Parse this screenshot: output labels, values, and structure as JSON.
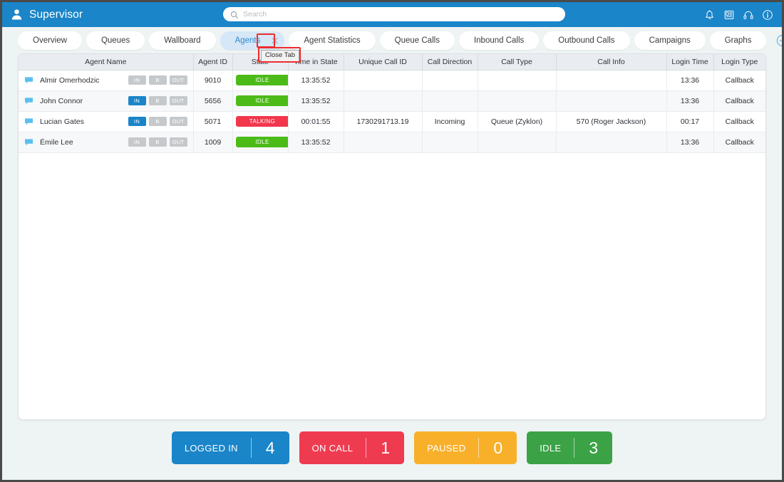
{
  "header": {
    "title": "Supervisor",
    "user_icon": "user-icon",
    "search": {
      "placeholder": "Search",
      "value": ""
    },
    "icons": [
      {
        "name": "bell-icon",
        "label": "Notifications"
      },
      {
        "name": "desk-phone-icon",
        "label": "Phone"
      },
      {
        "name": "headset-icon",
        "label": "Headset"
      },
      {
        "name": "info-icon",
        "label": "Info"
      }
    ],
    "accent_color": "#1a85c8"
  },
  "tabs": {
    "items": [
      {
        "label": "Overview",
        "active": false
      },
      {
        "label": "Queues",
        "active": false
      },
      {
        "label": "Wallboard",
        "active": false
      },
      {
        "label": "Agents",
        "active": true
      },
      {
        "label": "Agent Statistics",
        "active": false
      },
      {
        "label": "Queue Calls",
        "active": false
      },
      {
        "label": "Inbound Calls",
        "active": false
      },
      {
        "label": "Outbound Calls",
        "active": false
      },
      {
        "label": "Campaigns",
        "active": false
      },
      {
        "label": "Graphs",
        "active": false
      }
    ],
    "add_tab_icon": "plus-circle-icon",
    "close_icon": "close-icon",
    "tooltip": "Close Tab"
  },
  "table": {
    "columns": [
      "Agent Name",
      "Agent ID",
      "State",
      "Time in State",
      "Unique Call ID",
      "Call Direction",
      "Call Type",
      "Call Info",
      "Login Time",
      "Login Type"
    ],
    "badge_labels": {
      "in": "IN",
      "b": "B",
      "out": "OUT"
    },
    "rows": [
      {
        "agent_name": "Almir Omerhodzic",
        "badges": {
          "in": false,
          "b": false,
          "out": false
        },
        "agent_id": "9010",
        "state": "IDLE",
        "state_type": "idle",
        "time_in_state": "13:35:52",
        "unique_call_id": "",
        "call_direction": "",
        "call_type": "",
        "call_info": "",
        "login_time": "13:36",
        "login_type": "Callback"
      },
      {
        "agent_name": "John Connor",
        "badges": {
          "in": true,
          "b": false,
          "out": false
        },
        "agent_id": "5656",
        "state": "IDLE",
        "state_type": "idle",
        "time_in_state": "13:35:52",
        "unique_call_id": "",
        "call_direction": "",
        "call_type": "",
        "call_info": "",
        "login_time": "13:36",
        "login_type": "Callback"
      },
      {
        "agent_name": "Lucian Gates",
        "badges": {
          "in": true,
          "b": false,
          "out": false
        },
        "agent_id": "5071",
        "state": "TALKING",
        "state_type": "talking",
        "time_in_state": "00:01:55",
        "unique_call_id": "1730291713.19",
        "call_direction": "Incoming",
        "call_type": "Queue (Zyklon)",
        "call_info": "570 (Roger Jackson)",
        "login_time": "00:17",
        "login_type": "Callback"
      },
      {
        "agent_name": "Émile Lee",
        "badges": {
          "in": false,
          "b": false,
          "out": false
        },
        "agent_id": "1009",
        "state": "IDLE",
        "state_type": "idle",
        "time_in_state": "13:35:52",
        "unique_call_id": "",
        "call_direction": "",
        "call_type": "",
        "call_info": "",
        "login_time": "13:36",
        "login_type": "Callback"
      }
    ]
  },
  "footer_stats": [
    {
      "label": "LOGGED IN",
      "value": "4",
      "color": "#1a85c8"
    },
    {
      "label": "ON CALL",
      "value": "1",
      "color": "#ef3b50"
    },
    {
      "label": "PAUSED",
      "value": "0",
      "color": "#f8b02a"
    },
    {
      "label": "IDLE",
      "value": "3",
      "color": "#3ba346"
    }
  ]
}
